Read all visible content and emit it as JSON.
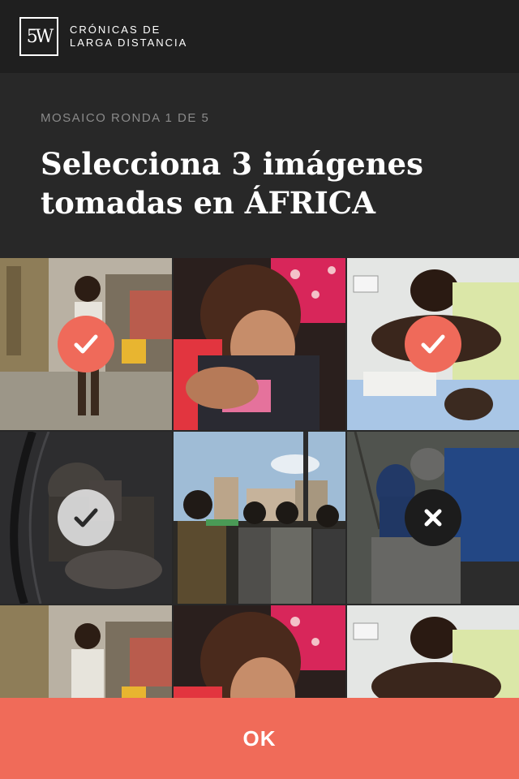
{
  "header": {
    "logo_text": "5W",
    "brand_line1": "CRÓNICAS DE",
    "brand_line2": "LARGA DISTANCIA"
  },
  "quiz": {
    "round_label": "MOSAICO RONDA 1 DE 5",
    "title_line1": "Selecciona 3 imágenes",
    "title_line2": "tomadas en ÁFRICA"
  },
  "grid": {
    "tiles": [
      {
        "subject": "child-standing-in-dusty-street",
        "state": "selected-correct"
      },
      {
        "subject": "mother-holding-child-in-life-jacket",
        "state": "none"
      },
      {
        "subject": "man-in-hospital-with-patient",
        "state": "selected-correct"
      },
      {
        "subject": "sleeping-woman-with-baby",
        "state": "selected-gray"
      },
      {
        "subject": "group-looking-at-city-buildings",
        "state": "none"
      },
      {
        "subject": "people-in-rain-jackets",
        "state": "wrong"
      },
      {
        "subject": "child-standing-in-dusty-street",
        "state": "none"
      },
      {
        "subject": "mother-holding-child-in-life-jacket",
        "state": "none"
      },
      {
        "subject": "man-in-hospital-with-patient",
        "state": "none"
      }
    ],
    "colors": {
      "accent": "#ef6a5a",
      "dark_badge": "#1c1c1c",
      "gray_badge": "#e1e1e1"
    }
  },
  "footer": {
    "ok_label": "OK"
  }
}
